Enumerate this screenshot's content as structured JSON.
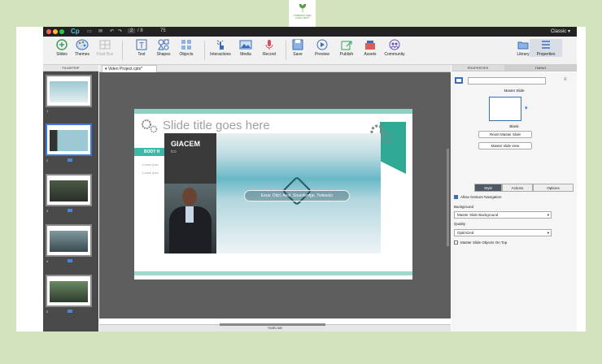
{
  "logo": {
    "text": "COMPANY AND\nLOGO TEXT"
  },
  "titlebar": {
    "app": "Cp",
    "page": "2",
    "total": "/ 8",
    "zoom": "75",
    "workspace": "Classic"
  },
  "toolbar": {
    "slides": "Slides",
    "themes": "Themes",
    "fluid": "Fluid Box",
    "text": "Text",
    "shapes": "Shapes",
    "objects": "Objects",
    "interactions": "Interactions",
    "media": "Media",
    "record": "Record",
    "save": "Save",
    "preview": "Preview",
    "publish": "Publish",
    "assets": "Assets",
    "community": "Community",
    "library": "Library",
    "properties": "Properties"
  },
  "filmstrip": {
    "header": "FILMSTRIP",
    "slides": [
      "1",
      "2",
      "3",
      "4",
      "5"
    ]
  },
  "doc": {
    "tab": "Video Project.cptx*"
  },
  "slide": {
    "title": "Slide title goes here",
    "body_label": "BODY H",
    "lorem1": "Lorem ipsu",
    "lorem2": "Lorem ipsu",
    "presenter_name": "GIACEM",
    "presenter_sub": "tco",
    "video_caption": "Eeuv, Oitzl, Aeol, Soucdenfge, Twteaclo"
  },
  "timeline": {
    "label": "TIMELINE"
  },
  "properties": {
    "tabs": [
      "PROPERTIES",
      "TIMING"
    ],
    "master_label": "Master Slide",
    "thumb_label": "Blank",
    "reset_btn": "Reset Master Slide",
    "view_btn": "Master slide view",
    "segments": [
      "Style",
      "Actions",
      "Options"
    ],
    "allow_gesture": "Allow Gesture Navigation",
    "background_label": "Background",
    "background_value": "Master Slide Background",
    "quality_label": "Quality",
    "quality_value": "Optimized",
    "master_on_top": "Master Slide Objects On Top"
  },
  "colors": {
    "accent": "#3db8a8",
    "selection": "#3f7ad8",
    "stage": "#5e5e5e",
    "brand": "#4fc3e0"
  }
}
